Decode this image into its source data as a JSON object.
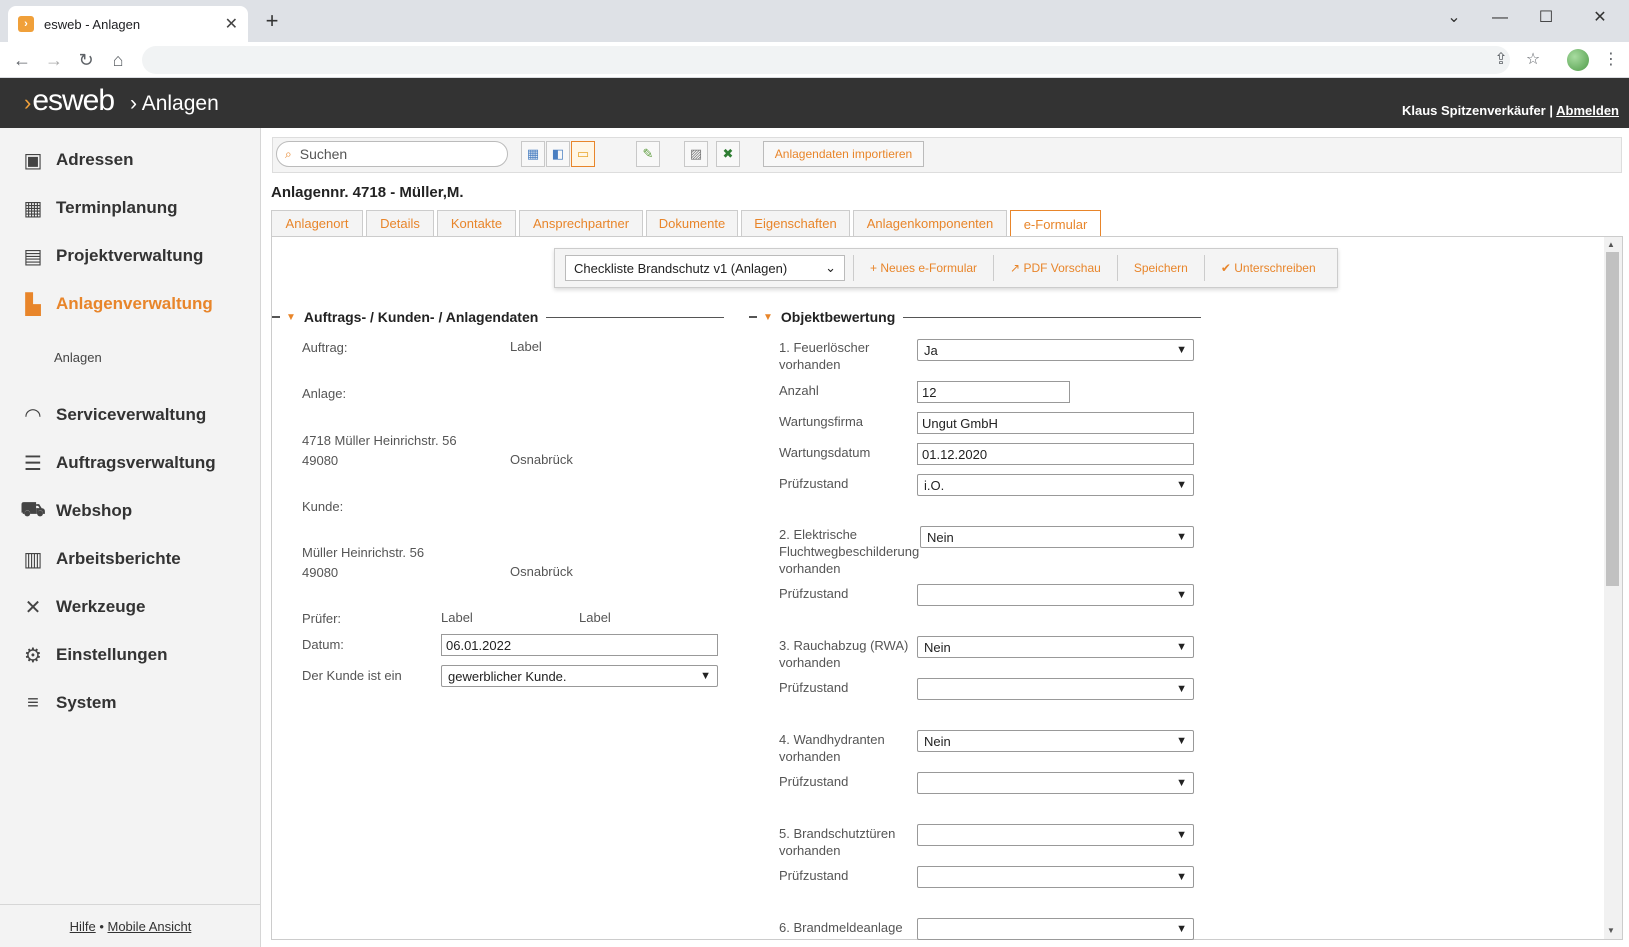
{
  "browser": {
    "tab_title": "esweb - Anlagen",
    "tab_close": "✕",
    "new_tab": "+"
  },
  "header": {
    "logo": "esweb",
    "breadcrumb": "Anlagen",
    "user": "Klaus Spitzenverkäufer",
    "separator": "|",
    "logout": "Abmelden"
  },
  "sidebar": {
    "items": [
      {
        "label": "Adressen",
        "icon": "address-book-icon"
      },
      {
        "label": "Terminplanung",
        "icon": "calendar-icon"
      },
      {
        "label": "Projektverwaltung",
        "icon": "gantt-icon"
      },
      {
        "label": "Anlagenverwaltung",
        "icon": "factory-icon",
        "active": true
      },
      {
        "label": "Serviceverwaltung",
        "icon": "headset-icon"
      },
      {
        "label": "Auftragsverwaltung",
        "icon": "list-icon"
      },
      {
        "label": "Webshop",
        "icon": "cart-icon"
      },
      {
        "label": "Arbeitsberichte",
        "icon": "clipboard-icon"
      },
      {
        "label": "Werkzeuge",
        "icon": "tools-icon"
      },
      {
        "label": "Einstellungen",
        "icon": "gears-icon"
      },
      {
        "label": "System",
        "icon": "database-icon"
      }
    ],
    "subitem": "Anlagen",
    "footer_help": "Hilfe",
    "footer_dot": "•",
    "footer_mobile": "Mobile Ansicht"
  },
  "toolbar": {
    "search_placeholder": "Suchen",
    "import_label": "Anlagendaten importieren"
  },
  "page_title": "Anlagennr. 4718 - Müller,M.",
  "tabs": [
    "Anlagenort",
    "Details",
    "Kontakte",
    "Ansprechpartner",
    "Dokumente",
    "Eigenschaften",
    "Anlagenkomponenten",
    "e-Formular"
  ],
  "active_tab": "e-Formular",
  "formbar": {
    "selected_form": "Checkliste Brandschutz v1 (Anlagen)",
    "new_form": "Neues e-Formular",
    "pdf_preview": "PDF Vorschau",
    "save": "Speichern",
    "sign": "Unterschreiben"
  },
  "left_section": {
    "title": "Auftrags- / Kunden- / Anlagendaten",
    "auftrag_label": "Auftrag:",
    "auftrag_value": "Label",
    "anlage_label": "Anlage:",
    "anlage_line1": "4718 Müller Heinrichstr. 56",
    "anlage_line2": "49080",
    "anlage_city": "Osnabrück",
    "kunde_label": "Kunde:",
    "kunde_line1": "Müller Heinrichstr. 56",
    "kunde_line2": "49080",
    "kunde_city": "Osnabrück",
    "pruefer_label": "Prüfer:",
    "pruefer_value1": "Label",
    "pruefer_value2": "Label",
    "datum_label": "Datum:",
    "datum_value": "06.01.2022",
    "kundetyp_label": "Der Kunde ist ein",
    "kundetyp_value": "gewerblicher Kunde."
  },
  "right_section": {
    "title": "Objektbewertung",
    "q1_label": "1. Feuerlöscher vorhanden",
    "q1_value": "Ja",
    "anzahl_label": "Anzahl",
    "anzahl_value": "12",
    "wartungsfirma_label": "Wartungsfirma",
    "wartungsfirma_value": "Ungut GmbH",
    "wartungsdatum_label": "Wartungsdatum",
    "wartungsdatum_value": "01.12.2020",
    "pruefzustand_label": "Prüfzustand",
    "pruefzustand1_value": "i.O.",
    "q2_label": "2. Elektrische Fluchtwegbeschilderung vorhanden",
    "q2_value": "Nein",
    "q3_label": "3. Rauchabzug (RWA) vorhanden",
    "q3_value": "Nein",
    "q4_label": "4. Wandhydranten vorhanden",
    "q4_value": "Nein",
    "q5_label": "5. Brandschutztüren vorhanden",
    "q6_label": "6. Brandmeldeanlage"
  }
}
